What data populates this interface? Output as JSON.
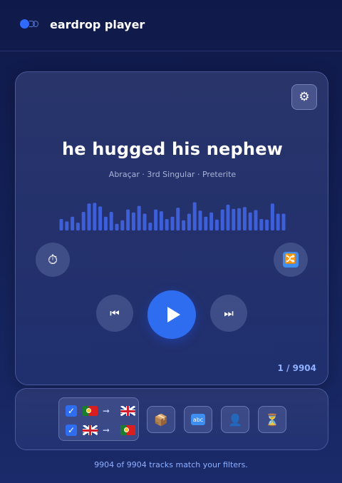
{
  "header": {
    "title": "eardrop player"
  },
  "player": {
    "phrase": "he hugged his nephew",
    "meta": "Abraçar · 3rd Singular · Preterite",
    "counter": "1 / 9904",
    "waveform_levels": [
      0.38,
      0.3,
      0.46,
      0.26,
      0.62,
      0.9,
      0.92,
      0.8,
      0.46,
      0.62,
      0.22,
      0.34,
      0.7,
      0.6,
      0.82,
      0.56,
      0.26,
      0.7,
      0.64,
      0.38,
      0.46,
      0.76,
      0.34,
      0.56,
      0.94,
      0.66,
      0.46,
      0.6,
      0.36,
      0.7,
      0.86,
      0.72,
      0.74,
      0.78,
      0.6,
      0.68,
      0.38,
      0.36,
      0.9,
      0.56,
      0.56
    ],
    "waveform_color": "#3d5fd8",
    "accent_color": "#2f6df0",
    "icons": {
      "settings": "gear-icon",
      "timer": "stopwatch-icon",
      "shuffle": "shuffle-icon",
      "prev": "previous-track-icon",
      "play": "play-icon",
      "next": "next-track-icon"
    }
  },
  "filters": {
    "directions": [
      {
        "checked": true,
        "from": "portugal-flag-icon",
        "to": "uk-flag-icon"
      },
      {
        "checked": true,
        "from": "uk-flag-icon",
        "to": "portugal-flag-icon"
      }
    ],
    "chips": [
      {
        "name": "package-icon",
        "glyph": "📦"
      },
      {
        "name": "abc-icon",
        "glyph": "abc"
      },
      {
        "name": "person-icon",
        "glyph": "👤"
      },
      {
        "name": "hourglass-icon",
        "glyph": "⏳"
      }
    ]
  },
  "footer": {
    "text": "9904 of 9904 tracks match your filters."
  }
}
